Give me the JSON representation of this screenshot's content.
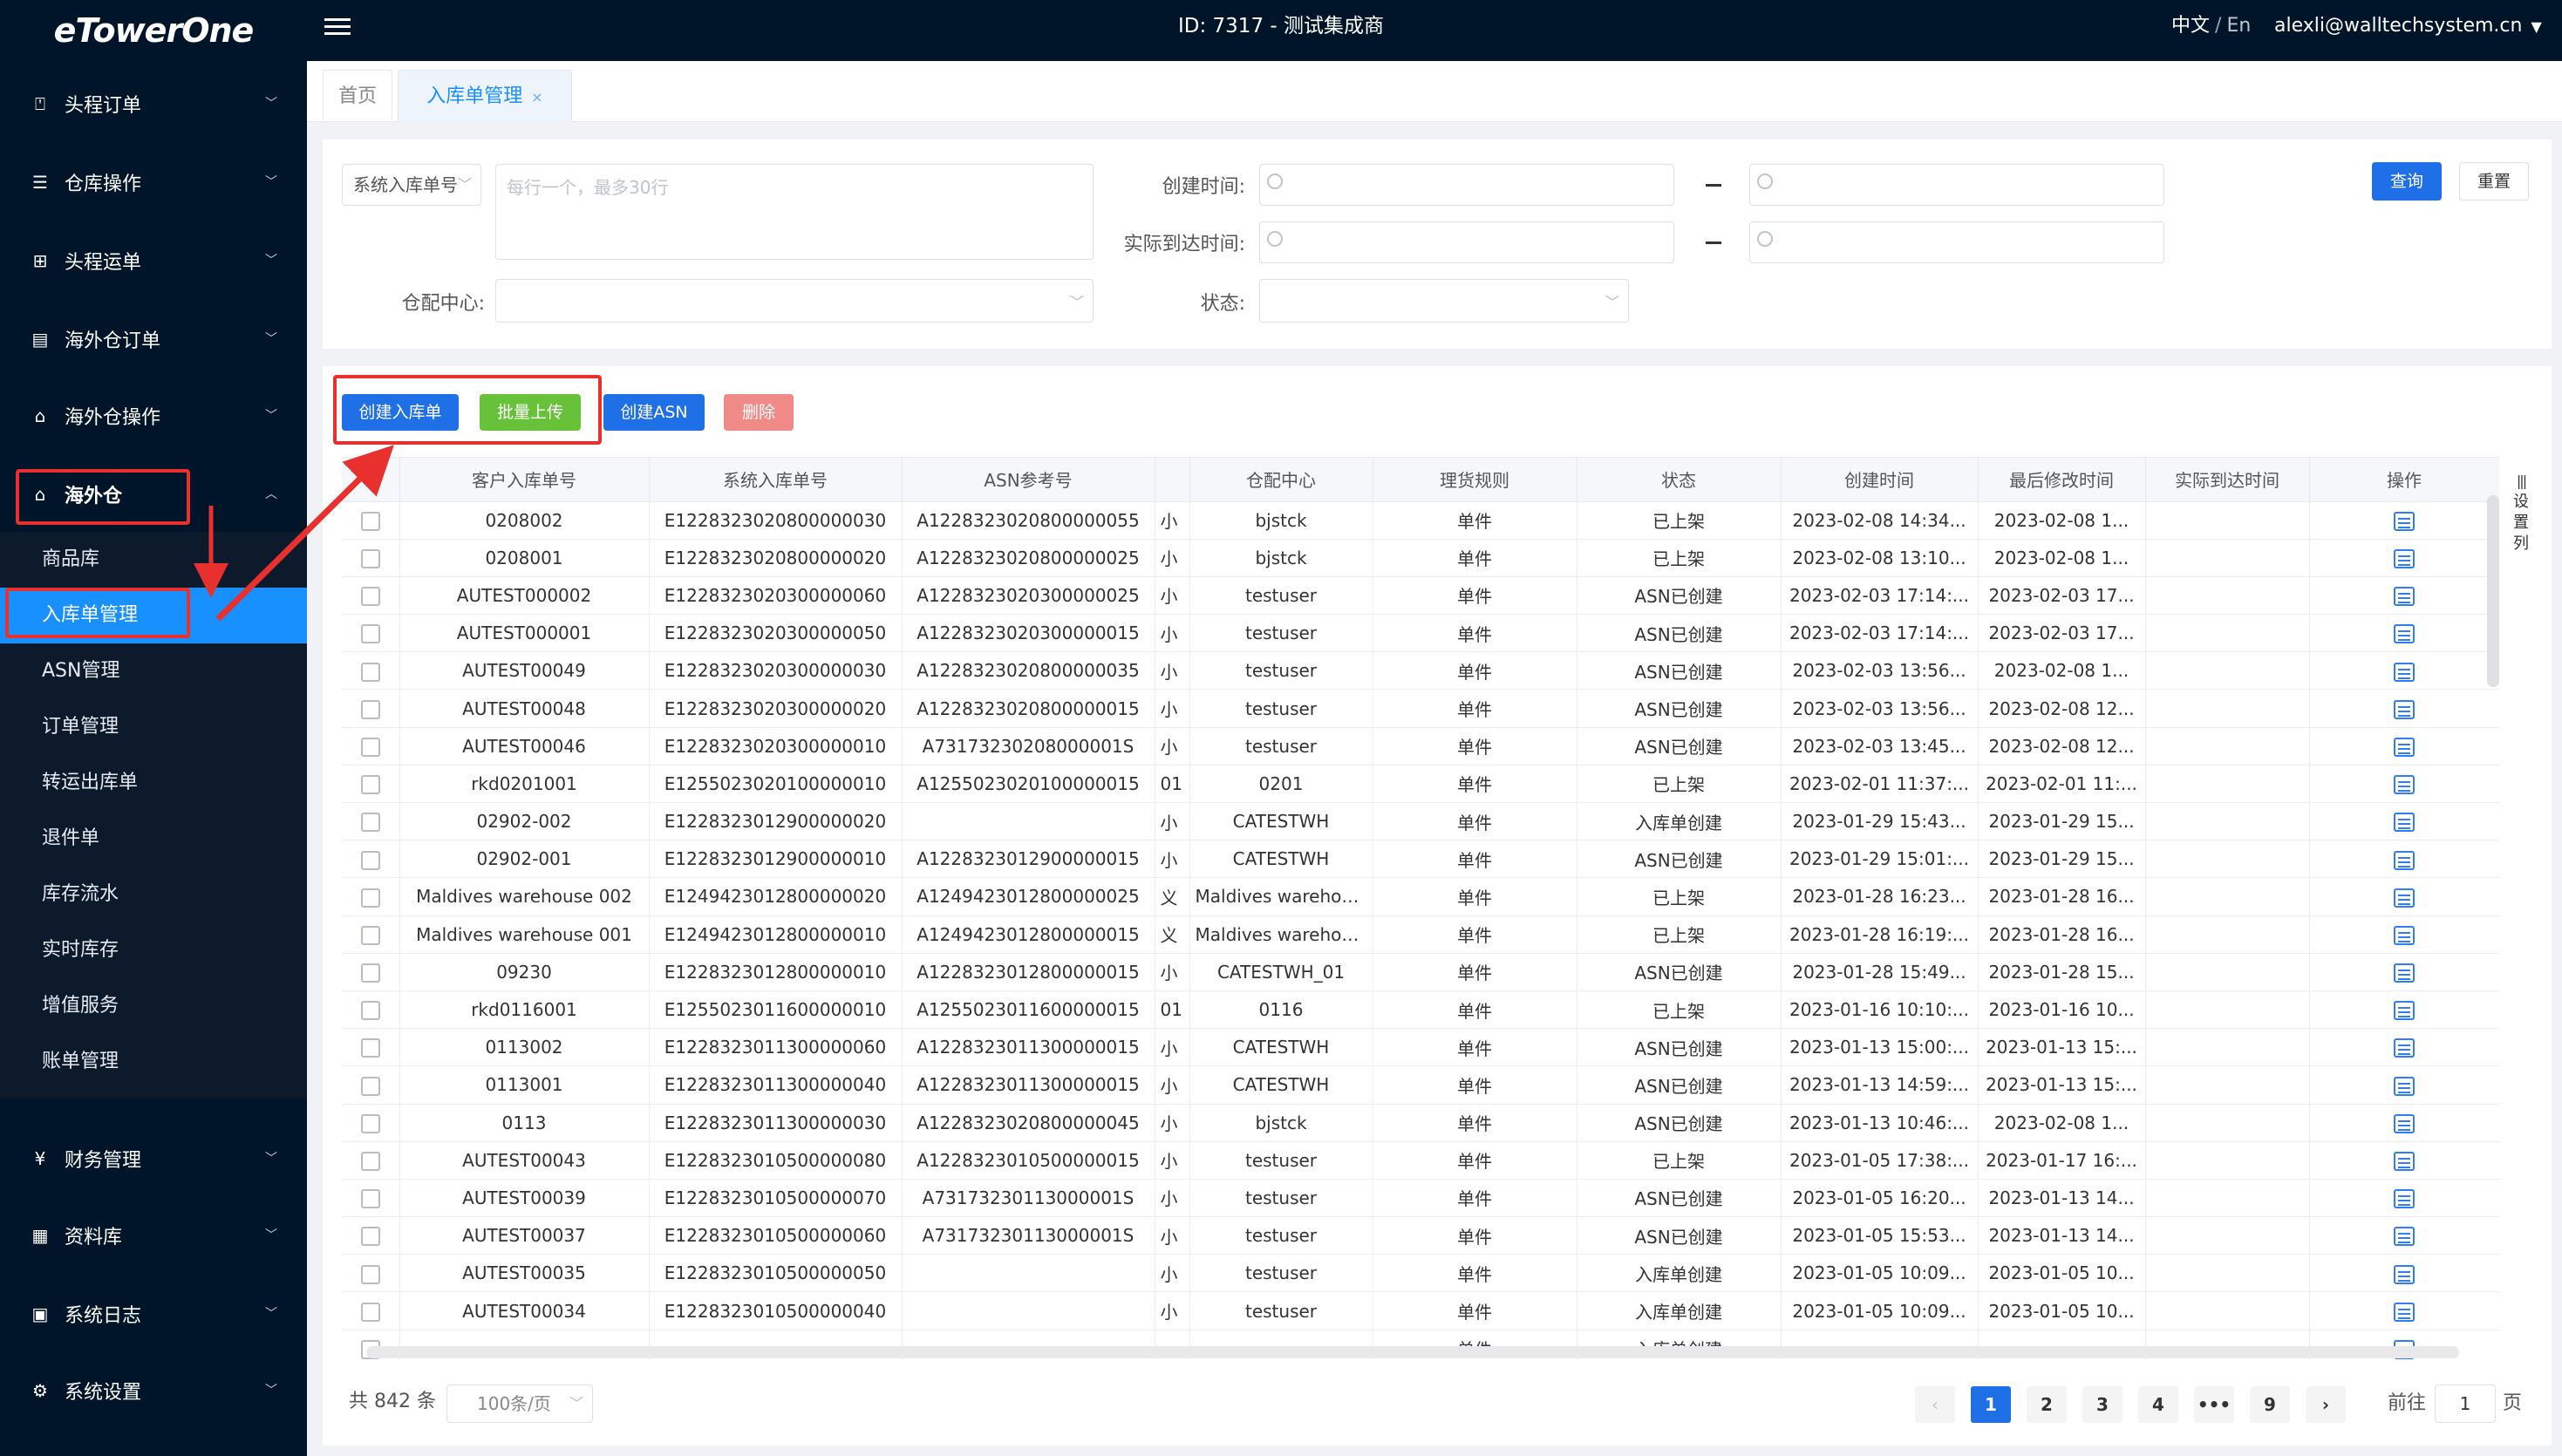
{
  "header": {
    "logo": "eTowerOne",
    "title": "ID: 7317 - 测试集成商",
    "lang_cn": "中文",
    "lang_sep": "/",
    "lang_en": "En",
    "user": "alexli@walltechsystem.cn"
  },
  "sidebar": {
    "items": [
      {
        "label": "头程订单",
        "icon": "order-icon"
      },
      {
        "label": "仓库操作",
        "icon": "warehouse-ops-icon"
      },
      {
        "label": "头程运单",
        "icon": "waybill-icon"
      },
      {
        "label": "海外仓订单",
        "icon": "overseas-order-icon"
      },
      {
        "label": "海外仓操作",
        "icon": "overseas-ops-icon"
      },
      {
        "label": "海外仓",
        "icon": "warehouse-icon"
      },
      {
        "label": "财务管理",
        "icon": "finance-icon"
      },
      {
        "label": "资料库",
        "icon": "database-icon"
      },
      {
        "label": "系统日志",
        "icon": "log-icon"
      },
      {
        "label": "系统设置",
        "icon": "settings-icon"
      }
    ],
    "submenu": [
      "商品库",
      "入库单管理",
      "ASN管理",
      "订单管理",
      "转运出库单",
      "退件单",
      "库存流水",
      "实时库存",
      "增值服务",
      "账单管理"
    ]
  },
  "tabs": {
    "home": "首页",
    "current": "入库单管理",
    "close": "×"
  },
  "filter": {
    "type_select": "系统入库单号",
    "order_placeholder": "每行一个，最多30行",
    "created_label": "创建时间:",
    "arrival_label": "实际到达时间:",
    "center_label": "仓配中心:",
    "status_label": "状态:",
    "search_button": "查询",
    "reset_button": "重置"
  },
  "actions": {
    "create_inbound": "创建入库单",
    "batch_upload": "批量上传",
    "create_asn": "创建ASN",
    "delete": "删除"
  },
  "table": {
    "headers": [
      "客户入库单号",
      "系统入库单号",
      "ASN参考号",
      "",
      "仓配中心",
      "理货规则",
      "状态",
      "创建时间",
      "最后修改时间",
      "实际到达时间",
      "操作"
    ],
    "rows": [
      [
        "0208002",
        "E1228323020800000030",
        "A1228323020800000055",
        "小",
        "bjstck",
        "单件",
        "已上架",
        "2023-02-08 14:34...",
        "2023-02-08 1...",
        ""
      ],
      [
        "0208001",
        "E1228323020800000020",
        "A1228323020800000025",
        "小",
        "bjstck",
        "单件",
        "已上架",
        "2023-02-08 13:10...",
        "2023-02-08 1...",
        ""
      ],
      [
        "AUTEST000002",
        "E1228323020300000060",
        "A1228323020300000025",
        "小",
        "testuser",
        "单件",
        "ASN已创建",
        "2023-02-03 17:14:...",
        "2023-02-03 17...",
        ""
      ],
      [
        "AUTEST000001",
        "E1228323020300000050",
        "A1228323020300000015",
        "小",
        "testuser",
        "单件",
        "ASN已创建",
        "2023-02-03 17:14:...",
        "2023-02-03 17...",
        ""
      ],
      [
        "AUTEST00049",
        "E1228323020300000030",
        "A1228323020800000035",
        "小",
        "testuser",
        "单件",
        "ASN已创建",
        "2023-02-03 13:56...",
        "2023-02-08 1...",
        ""
      ],
      [
        "AUTEST00048",
        "E1228323020300000020",
        "A1228323020800000015",
        "小",
        "testuser",
        "单件",
        "ASN已创建",
        "2023-02-03 13:56...",
        "2023-02-08 12...",
        ""
      ],
      [
        "AUTEST00046",
        "E1228323020300000010",
        "A73173230208000001S",
        "小",
        "testuser",
        "单件",
        "ASN已创建",
        "2023-02-03 13:45...",
        "2023-02-08 12...",
        ""
      ],
      [
        "rkd0201001",
        "E1255023020100000010",
        "A1255023020100000015",
        "01",
        "0201",
        "单件",
        "已上架",
        "2023-02-01 11:37:...",
        "2023-02-01 11:...",
        ""
      ],
      [
        "02902-002",
        "E1228323012900000020",
        "",
        "小",
        "CATESTWH",
        "单件",
        "入库单创建",
        "2023-01-29 15:43...",
        "2023-01-29 15...",
        ""
      ],
      [
        "02902-001",
        "E1228323012900000010",
        "A1228323012900000015",
        "小",
        "CATESTWH",
        "单件",
        "ASN已创建",
        "2023-01-29 15:01:...",
        "2023-01-29 15...",
        ""
      ],
      [
        "Maldives warehouse 002",
        "E1249423012800000020",
        "A1249423012800000025",
        "义",
        "Maldives warehouse",
        "单件",
        "已上架",
        "2023-01-28 16:23...",
        "2023-01-28 16...",
        ""
      ],
      [
        "Maldives warehouse 001",
        "E1249423012800000010",
        "A1249423012800000015",
        "义",
        "Maldives warehouse",
        "单件",
        "已上架",
        "2023-01-28 16:19:...",
        "2023-01-28 16...",
        ""
      ],
      [
        "09230",
        "E1228323012800000010",
        "A1228323012800000015",
        "小",
        "CATESTWH_01",
        "单件",
        "ASN已创建",
        "2023-01-28 15:49...",
        "2023-01-28 15...",
        ""
      ],
      [
        "rkd0116001",
        "E1255023011600000010",
        "A1255023011600000015",
        "01",
        "0116",
        "单件",
        "已上架",
        "2023-01-16 10:10:...",
        "2023-01-16 10...",
        ""
      ],
      [
        "0113002",
        "E1228323011300000060",
        "A1228323011300000015",
        "小",
        "CATESTWH",
        "单件",
        "ASN已创建",
        "2023-01-13 15:00:...",
        "2023-01-13 15:...",
        ""
      ],
      [
        "0113001",
        "E1228323011300000040",
        "A1228323011300000015",
        "小",
        "CATESTWH",
        "单件",
        "ASN已创建",
        "2023-01-13 14:59:...",
        "2023-01-13 15:...",
        ""
      ],
      [
        "0113",
        "E1228323011300000030",
        "A1228323020800000045",
        "小",
        "bjstck",
        "单件",
        "ASN已创建",
        "2023-01-13 10:46:...",
        "2023-02-08 1...",
        ""
      ],
      [
        "AUTEST00043",
        "E1228323010500000080",
        "A1228323010500000015",
        "小",
        "testuser",
        "单件",
        "已上架",
        "2023-01-05 17:38:...",
        "2023-01-17 16:...",
        ""
      ],
      [
        "AUTEST00039",
        "E1228323010500000070",
        "A73173230113000001S",
        "小",
        "testuser",
        "单件",
        "ASN已创建",
        "2023-01-05 16:20...",
        "2023-01-13 14...",
        ""
      ],
      [
        "AUTEST00037",
        "E1228323010500000060",
        "A73173230113000001S",
        "小",
        "testuser",
        "单件",
        "ASN已创建",
        "2023-01-05 15:53...",
        "2023-01-13 14...",
        ""
      ],
      [
        "AUTEST00035",
        "E1228323010500000050",
        "",
        "小",
        "testuser",
        "单件",
        "入库单创建",
        "2023-01-05 10:09...",
        "2023-01-05 10...",
        ""
      ],
      [
        "AUTEST00034",
        "E1228323010500000040",
        "",
        "小",
        "testuser",
        "单件",
        "入库单创建",
        "2023-01-05 10:09...",
        "2023-01-05 10...",
        ""
      ],
      [
        "",
        "",
        "",
        "",
        "",
        "单件",
        "入库单创建",
        "",
        "",
        ""
      ]
    ],
    "set_columns": "设置列"
  },
  "pagination": {
    "total": "共 842 条",
    "per_page": "100条/页",
    "pages": [
      "1",
      "2",
      "3",
      "4",
      "•••",
      "9"
    ],
    "prev": "‹",
    "next": "›",
    "goto_label": "前往",
    "goto_value": "1",
    "goto_suffix": "页"
  },
  "colors": {
    "header_bg": "#001529",
    "active_blue": "#1890ff",
    "button_blue": "#1f6fe6",
    "button_green": "#67c23a",
    "button_red": "#f56c6c",
    "annotation_red": "#e8312e"
  }
}
